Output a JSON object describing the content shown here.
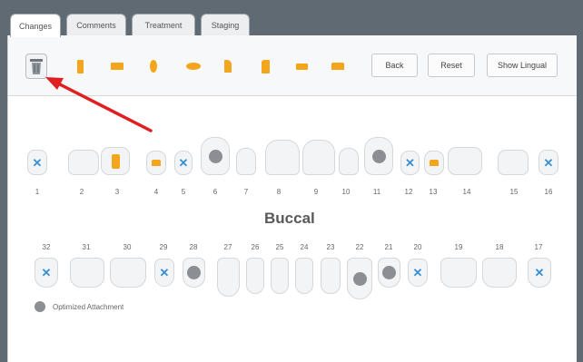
{
  "tabs": [
    {
      "label": "Changes",
      "active": true
    },
    {
      "label": "Comments",
      "active": false
    },
    {
      "label": "Treatment",
      "active": false
    },
    {
      "label": "Staging",
      "active": false
    }
  ],
  "toolbar": {
    "tools": [
      "trash-icon",
      "vertical-rectangular-attachment-icon",
      "horizontal-rectangular-attachment-icon",
      "vertical-ellipsoid-attachment-icon",
      "horizontal-ellipsoid-attachment-icon",
      "bevelled-attachment-icon",
      "stepped-attachment-icon",
      "occlusal-ramp-icon",
      "precision-cut-icon"
    ],
    "back_label": "Back",
    "reset_label": "Reset",
    "lingual_label": "Show Lingual"
  },
  "upper_numbers": [
    "1",
    "2",
    "3",
    "4",
    "5",
    "6",
    "7",
    "8",
    "9",
    "10",
    "11",
    "12",
    "13",
    "14",
    "15",
    "16"
  ],
  "lower_numbers": [
    "32",
    "31",
    "30",
    "29",
    "28",
    "27",
    "26",
    "25",
    "24",
    "23",
    "22",
    "21",
    "20",
    "19",
    "18",
    "17"
  ],
  "view_label": "Buccal",
  "legend": {
    "label": "Optimized Attachment"
  },
  "colors": {
    "attachment_gold": "#f3a51c",
    "removed_blue": "#3a8fd0",
    "optimized_gray": "#8b8f93",
    "arrow_red": "#e02020"
  }
}
